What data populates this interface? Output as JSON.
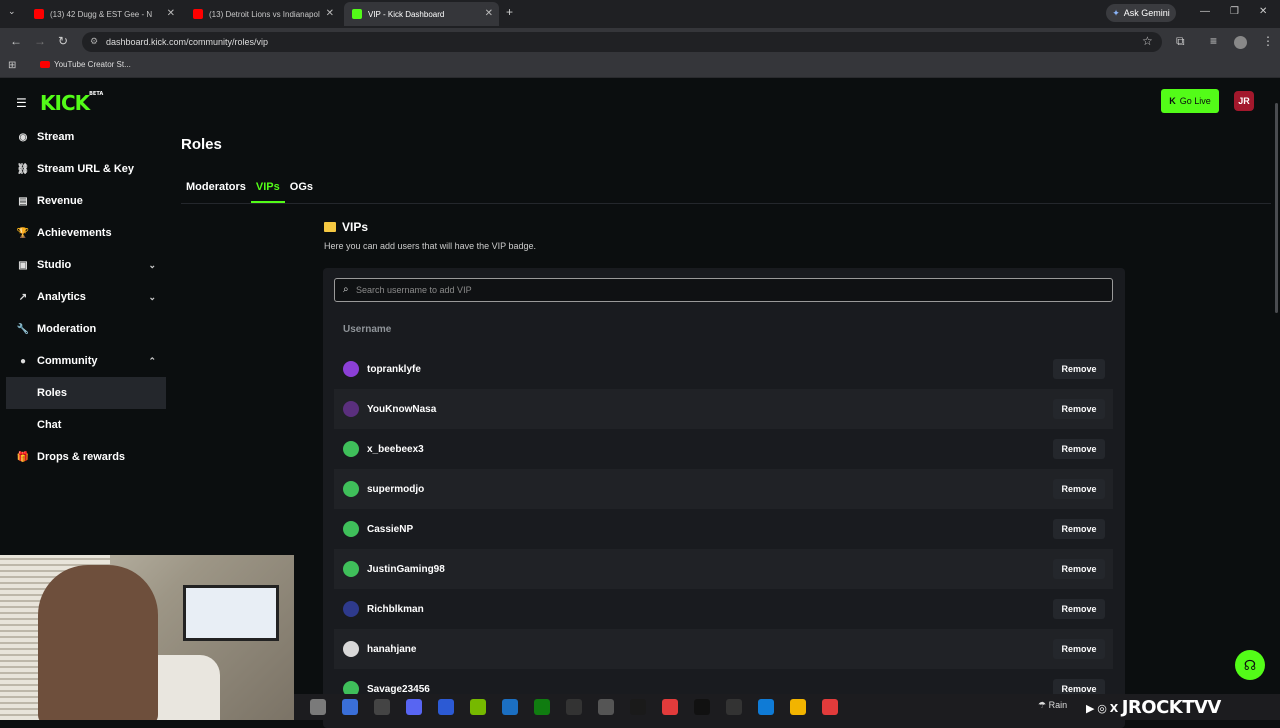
{
  "browser": {
    "tabs": [
      {
        "title": "(13) 42 Dugg & EST Gee - N",
        "fav_color": "#ff0000"
      },
      {
        "title": "(13) Detroit Lions vs Indianapol",
        "fav_color": "#ff0000"
      },
      {
        "title": "VIP - Kick Dashboard",
        "fav_color": "#53fc18"
      }
    ],
    "new_tab": "+",
    "ask_gemini": "Ask Gemini",
    "url": "dashboard.kick.com/community/roles/vip",
    "bookmark": "YouTube Creator St..."
  },
  "header": {
    "logo": "KICK",
    "logo_tag": "BETA",
    "go_live": "Go Live",
    "avatar_initials": "JR"
  },
  "sidebar": {
    "items": [
      {
        "label": "Stream",
        "icon": "stream-icon",
        "glyph": "◉"
      },
      {
        "label": "Stream URL & Key",
        "icon": "link-icon",
        "glyph": "⛓"
      },
      {
        "label": "Revenue",
        "icon": "revenue-icon",
        "glyph": "▤"
      },
      {
        "label": "Achievements",
        "icon": "trophy-icon",
        "glyph": "🏆"
      },
      {
        "label": "Studio",
        "icon": "studio-icon",
        "glyph": "▣",
        "chevron": "down"
      },
      {
        "label": "Analytics",
        "icon": "analytics-icon",
        "glyph": "↗",
        "chevron": "down"
      },
      {
        "label": "Moderation",
        "icon": "wrench-icon",
        "glyph": "🔧"
      },
      {
        "label": "Community",
        "icon": "community-icon",
        "glyph": "●",
        "chevron": "up"
      }
    ],
    "community_sub": [
      {
        "label": "Roles",
        "active": true
      },
      {
        "label": "Chat",
        "active": false
      }
    ],
    "drops": {
      "label": "Drops & rewards",
      "icon": "gift-icon",
      "glyph": "🎁"
    }
  },
  "main": {
    "title": "Roles",
    "tabs": [
      {
        "label": "Moderators",
        "active": false
      },
      {
        "label": "VIPs",
        "active": true
      },
      {
        "label": "OGs",
        "active": false
      }
    ],
    "section_title": "VIPs",
    "section_desc": "Here you can add users that will have the VIP badge.",
    "search_placeholder": "Search username to add VIP",
    "column_header": "Username",
    "remove_label": "Remove",
    "users": [
      {
        "name": "topranklyfe",
        "color": "#8b3fd6"
      },
      {
        "name": "YouKnowNasa",
        "color": "#5a2f7d"
      },
      {
        "name": "x_beebeex3",
        "color": "#3fbf5a"
      },
      {
        "name": "supermodjo",
        "color": "#3fbf5a"
      },
      {
        "name": "CassieNP",
        "color": "#3fbf5a"
      },
      {
        "name": "JustinGaming98",
        "color": "#3fbf5a"
      },
      {
        "name": "Richblkman",
        "color": "#2e3a8c"
      },
      {
        "name": "hanahjane",
        "color": "#d8d8d8"
      },
      {
        "name": "Savage23456",
        "color": "#3fbf5a"
      }
    ]
  },
  "taskbar": {
    "weather": "Rain",
    "watermark": "JROCKTVV"
  }
}
